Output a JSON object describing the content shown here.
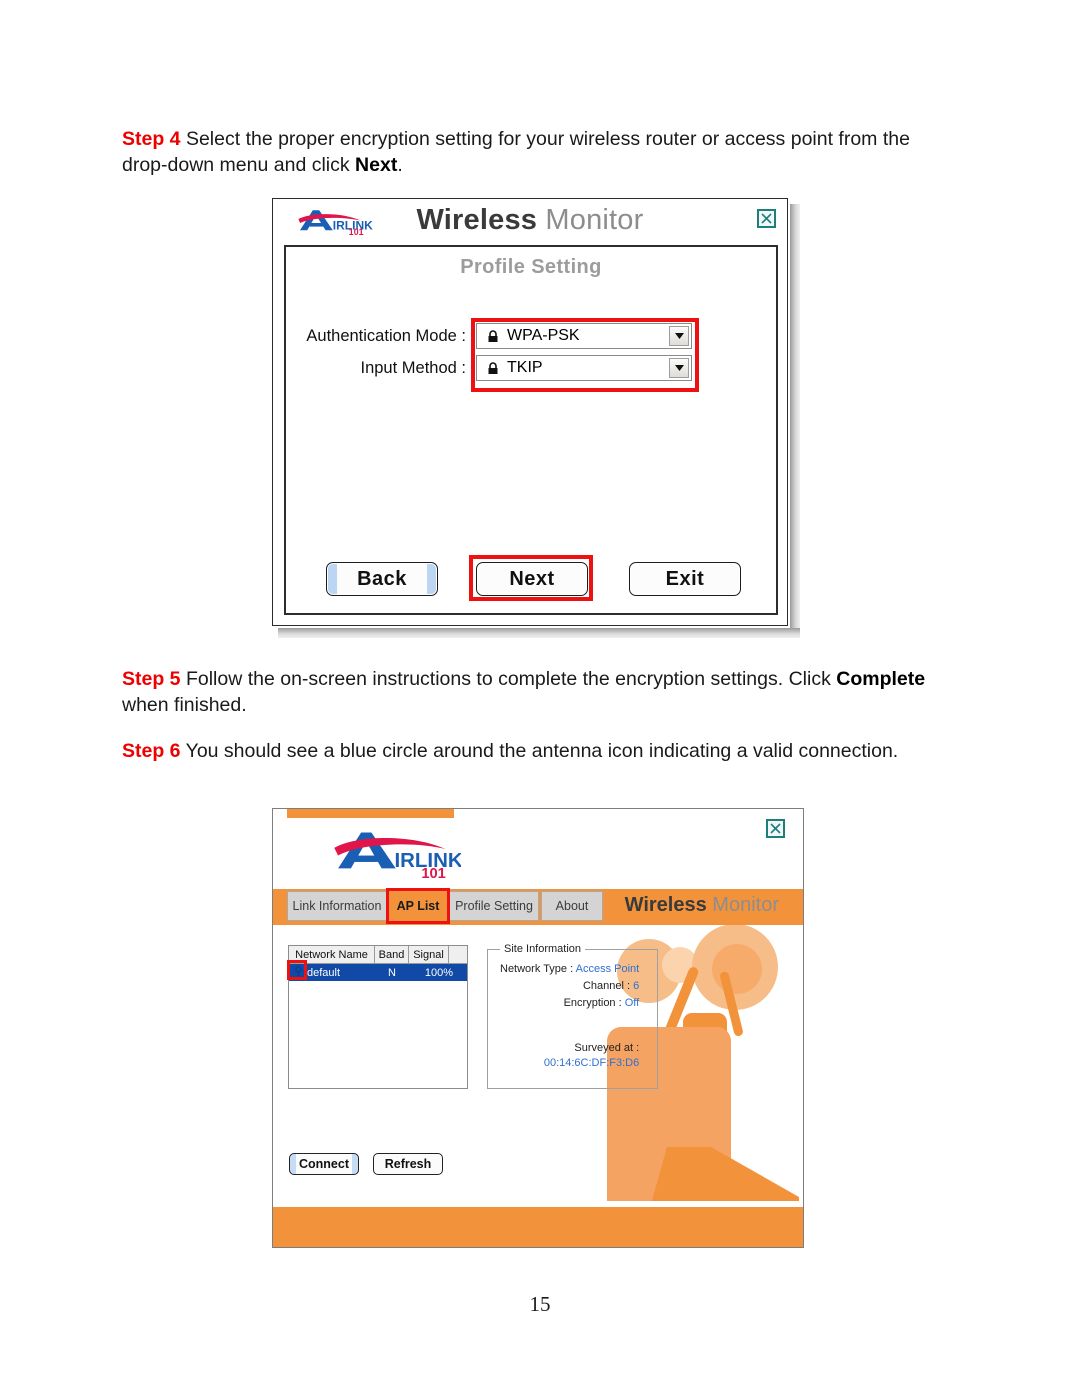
{
  "document": {
    "page_number": "15",
    "steps": [
      {
        "label": "Step 4",
        "text_before_bold": " Select the proper encryption setting for your wireless router or access point from the drop-down menu and click ",
        "bold": "Next",
        "text_after_bold": "."
      },
      {
        "label": "Step 5",
        "text_before_bold": " Follow the on-screen instructions to complete the encryption settings. Click ",
        "bold": "Complete",
        "text_after_bold": " when finished."
      },
      {
        "label": "Step 6",
        "text_before_bold": " You should see a blue circle around the antenna icon indicating a valid connection.",
        "bold": "",
        "text_after_bold": ""
      }
    ]
  },
  "colors": {
    "step_label": "#ee0000",
    "brand_orange": "#f2933c",
    "highlight_red": "#ee1111",
    "selection_blue": "#1049a6",
    "link_blue": "#2f6fd0",
    "close_teal": "#1d7f7c"
  },
  "dialog_profile": {
    "brand_bold": "Wireless",
    "brand_light": "Monitor",
    "logo_text": "AIRLINK 101",
    "close_icon": "close-icon",
    "panel_title": "Profile Setting",
    "fields": [
      {
        "label": "Authentication Mode :",
        "value": "WPA-PSK",
        "lock_icon": "lock-icon",
        "arrow_icon": "chevron-down-icon"
      },
      {
        "label": "Input Method :",
        "value": "TKIP",
        "lock_icon": "lock-icon",
        "arrow_icon": "chevron-down-icon"
      }
    ],
    "buttons": [
      {
        "label": "Back",
        "focused": true,
        "highlighted": false
      },
      {
        "label": "Next",
        "focused": false,
        "highlighted": true
      },
      {
        "label": "Exit",
        "focused": false,
        "highlighted": false
      }
    ]
  },
  "dialog_aplist": {
    "logo_text": "AIRLINK 101",
    "brand_bold": "Wireless",
    "brand_light": "Monitor",
    "close_icon": "close-icon",
    "tabs": [
      {
        "label": "Link Information",
        "active": false
      },
      {
        "label": "AP List",
        "active": true
      },
      {
        "label": "Profile Setting",
        "active": false
      },
      {
        "label": "About",
        "active": false
      }
    ],
    "table": {
      "headers": [
        "Network Name",
        "Band",
        "Signal"
      ],
      "rows": [
        {
          "icon": "antenna-icon",
          "name": "default",
          "band": "N",
          "signal": "100%",
          "selected": true
        }
      ]
    },
    "site_information": {
      "legend": "Site Information",
      "rows": [
        {
          "label": "Network Type :",
          "value": "Access Point"
        },
        {
          "label": "Channel :",
          "value": "6"
        },
        {
          "label": "Encryption :",
          "value": "Off"
        }
      ],
      "surveyed_label": "Surveyed at :",
      "surveyed_value": "00:14:6C:DF:F3:D6"
    },
    "buttons": [
      {
        "label": "Connect",
        "focused": true
      },
      {
        "label": "Refresh",
        "focused": false
      }
    ],
    "mascot_icon": "wireless-router-illustration"
  }
}
